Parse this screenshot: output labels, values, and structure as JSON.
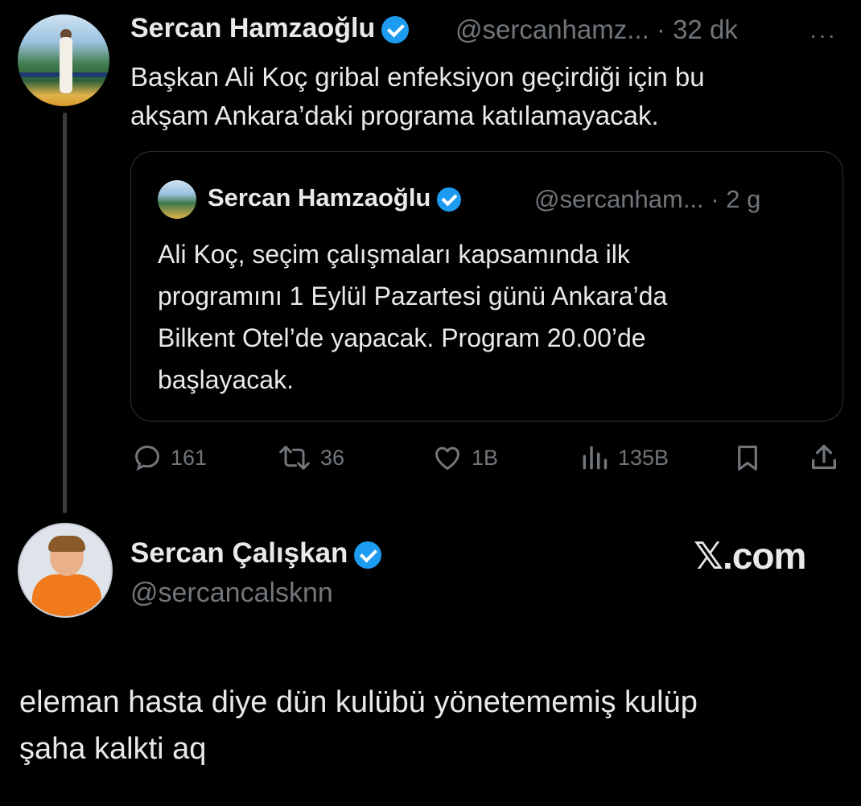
{
  "reply_context": {
    "author_name": "Sercan Hamzaoğlu",
    "author_handle": "@sercanhamz...",
    "time": "· 32 dk",
    "more_label": "···",
    "text_lines": [
      "Başkan Ali Koç gribal enfeksiyon geçirdiği için bu",
      "akşam Ankara’daki programa katılamayacak."
    ],
    "quote": {
      "author_name": "Sercan Hamzaoğlu",
      "author_handle": "@sercanham...",
      "time": "· 2 g",
      "text_lines": [
        "Ali Koç, seçim çalışmaları kapsamında ilk",
        "programını 1 Eylül Pazartesi günü Ankara’da",
        "Bilkent Otel’de yapacak. Program 20.00’de",
        "başlayacak."
      ]
    },
    "actions": {
      "replies": "161",
      "reposts": "36",
      "likes": "1B",
      "views": "135B"
    }
  },
  "main_post": {
    "author_name": "Sercan Çalışkan",
    "author_handle": "@sercancalsknn",
    "source_label": "𝕏.com",
    "text_lines": [
      "eleman hasta diye dün kulübü yönetememiş kulüp",
      "şaha kalkti aq"
    ]
  },
  "colors": {
    "background": "#000000",
    "text": "#e7e9ea",
    "muted": "#71767b",
    "verified": "#1d9bf0",
    "border": "#2f3336"
  }
}
